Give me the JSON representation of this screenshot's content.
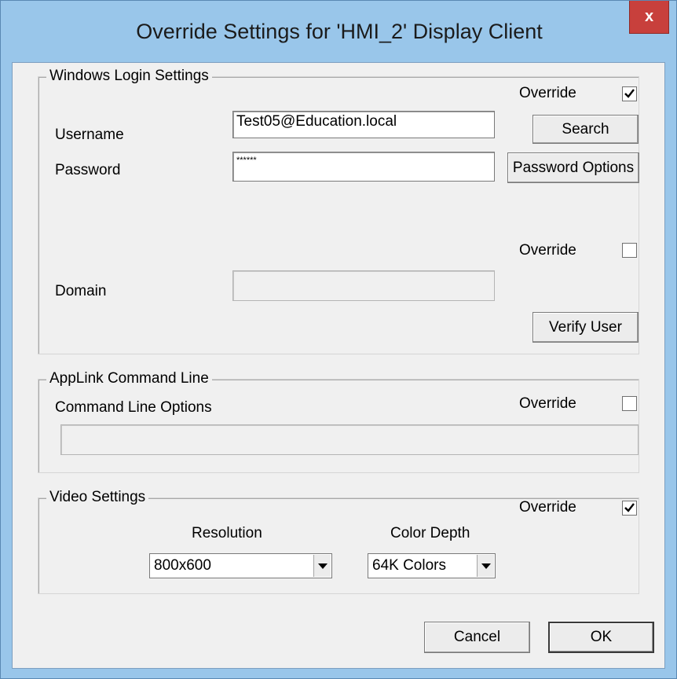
{
  "window": {
    "title": "Override Settings for 'HMI_2' Display Client",
    "close_glyph": "x"
  },
  "login": {
    "group_title": "Windows Login Settings",
    "override_label": "Override",
    "override_checked": true,
    "username_label": "Username",
    "username_value": "Test05@Education.local",
    "search_label": "Search",
    "password_label": "Password",
    "password_value": "******",
    "password_options_label": "Password Options",
    "domain_override_label": "Override",
    "domain_override_checked": false,
    "domain_label": "Domain",
    "domain_value": "",
    "verify_label": "Verify User"
  },
  "applink": {
    "group_title": "AppLink Command Line",
    "options_label": "Command Line Options",
    "override_label": "Override",
    "override_checked": false,
    "command_value": ""
  },
  "video": {
    "group_title": "Video Settings",
    "override_label": "Override",
    "override_checked": true,
    "resolution_label": "Resolution",
    "resolution_value": "800x600",
    "depth_label": "Color Depth",
    "depth_value": "64K Colors"
  },
  "footer": {
    "cancel_label": "Cancel",
    "ok_label": "OK"
  },
  "icons": {
    "close": "close-icon",
    "check": "checkmark-icon",
    "dropdown": "chevron-down-icon"
  }
}
